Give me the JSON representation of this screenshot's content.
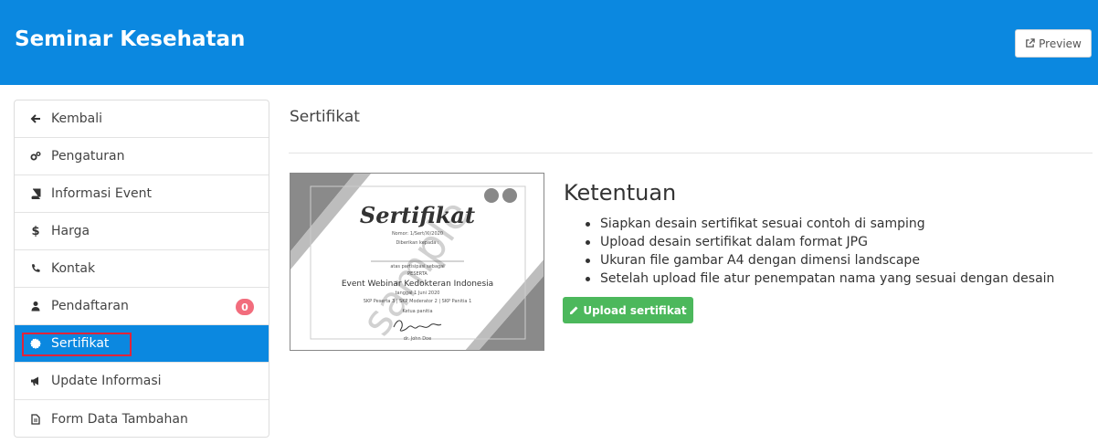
{
  "header": {
    "title": "Seminar Kesehatan",
    "preview_label": "Preview",
    "preview_icon": "external-link-icon"
  },
  "sidebar": {
    "items": [
      {
        "label": "Kembali",
        "icon": "arrow-left-icon"
      },
      {
        "label": "Pengaturan",
        "icon": "gears-icon"
      },
      {
        "label": "Informasi Event",
        "icon": "book-icon"
      },
      {
        "label": "Harga",
        "icon": "dollar-icon"
      },
      {
        "label": "Kontak",
        "icon": "phone-icon"
      },
      {
        "label": "Pendaftaran",
        "icon": "user-icon",
        "badge": "0"
      },
      {
        "label": "Sertifikat",
        "icon": "certificate-icon",
        "active": true
      },
      {
        "label": "Update Informasi",
        "icon": "megaphone-icon"
      },
      {
        "label": "Form Data Tambahan",
        "icon": "file-text-icon"
      }
    ]
  },
  "main": {
    "title": "Sertifikat",
    "certificate_preview": {
      "heading": "Sertifikat",
      "number": "Nomor: 1/Sert/XI/2020",
      "given_to": "Diberikan kepada :",
      "participation": "atas partisipasi sebagai",
      "role": "PESERTA",
      "event": "Event Webinar Kedokteran Indonesia",
      "date": "tanggal 1 Juni 2020",
      "skp": "SKP Peserta 3 | SKP Moderator 2 | SKP Panitia 1",
      "chair_label": "Ketua panitia",
      "signer": "dr. John Doe",
      "watermark": "sample"
    },
    "rules": {
      "heading": "Ketentuan",
      "items": [
        "Siapkan desain sertifikat sesuai contoh di samping",
        "Upload desain sertifikat dalam format JPG",
        "Ukuran file gambar A4 dengan dimensi landscape",
        "Setelah upload file atur penempatan nama yang sesuai dengan desain"
      ]
    },
    "upload_label": "Upload sertifikat",
    "upload_icon": "pencil-icon"
  },
  "colors": {
    "header_bg": "#0b88e0",
    "active_item_bg": "#0b88e0",
    "upload_button_bg": "#4cb85c",
    "badge_bg": "#f26d7d",
    "highlight_border": "#e0243a"
  }
}
